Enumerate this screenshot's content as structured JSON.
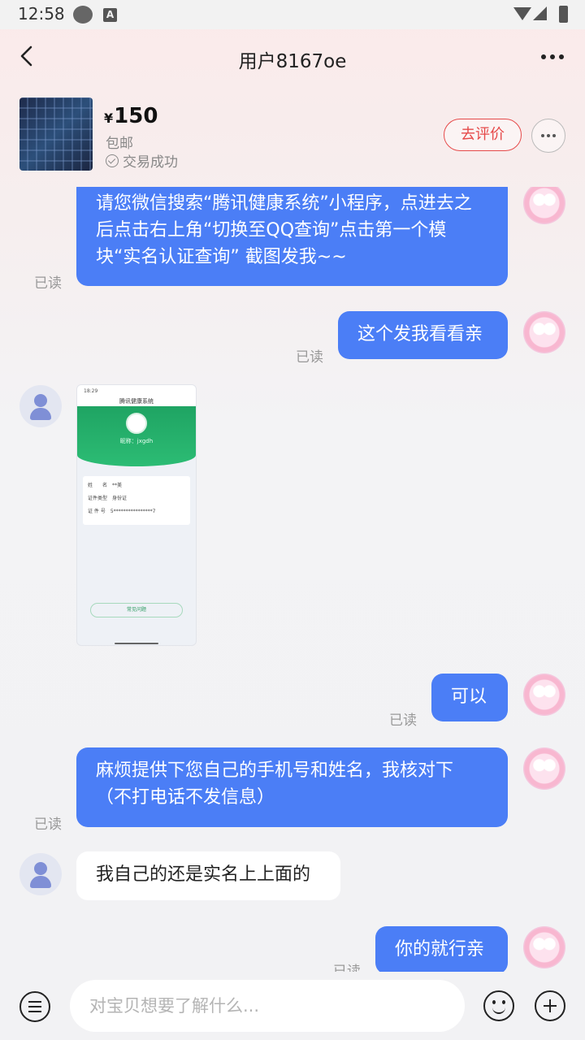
{
  "status_bar": {
    "time": "12:58",
    "notification_icon_letter": "A"
  },
  "header": {
    "title": "用户8167oe"
  },
  "product": {
    "currency": "¥",
    "price": "150",
    "shipping": "包邮",
    "trade_status": "交易成功",
    "review_label": "去评价"
  },
  "messages": [
    {
      "from": "me",
      "text": "请您微信搜索“腾讯健康系统”小程序，点进去之后点击右上角“切换至QQ查询”点击第一个模块“实名认证查询” 截图发我~~",
      "status": "已读"
    },
    {
      "from": "me",
      "text": "这个发我看看亲",
      "status": "已读"
    },
    {
      "from": "them",
      "type": "image"
    },
    {
      "from": "me",
      "text": "可以",
      "status": "已读"
    },
    {
      "from": "me",
      "text": "麻烦提供下您自己的手机号和姓名，我核对下（不打电话不发信息）",
      "status": "已读"
    },
    {
      "from": "them",
      "text": "我自己的还是实名上上面的"
    },
    {
      "from": "me",
      "text": "你的就行亲",
      "status": "已读"
    }
  ],
  "image_preview": {
    "time": "18:29",
    "title": "腾讯健康系统",
    "nickname": "昵称：jxgdh",
    "info": [
      "姓　　名　**美",
      "证件类型　身份证",
      "证 件 号　5****************7"
    ],
    "button": "常见问题"
  },
  "input": {
    "placeholder": "对宝贝想要了解什么..."
  },
  "colors": {
    "accent": "#4b7ef6",
    "review_red": "#e64a4a"
  }
}
